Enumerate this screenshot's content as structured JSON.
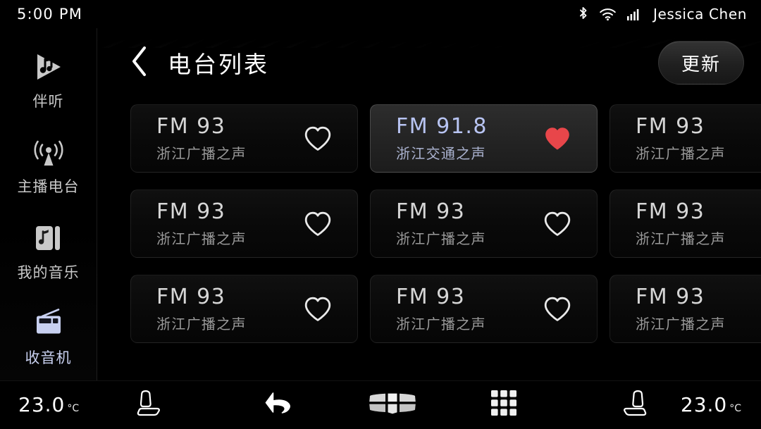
{
  "status_bar": {
    "clock": "5:00 PM",
    "user_name": "Jessica Chen",
    "icons": [
      "bluetooth-icon",
      "wifi-icon",
      "cellular-signal-icon"
    ]
  },
  "sidebar": {
    "items": [
      {
        "label": "伴听",
        "icon": "play-music-icon",
        "active": false
      },
      {
        "label": "主播电台",
        "icon": "broadcast-tower-icon",
        "active": false
      },
      {
        "label": "我的音乐",
        "icon": "music-album-icon",
        "active": false
      },
      {
        "label": "收音机",
        "icon": "radio-icon",
        "active": true
      }
    ]
  },
  "header": {
    "back_icon": "chevron-left-icon",
    "title": "电台列表",
    "update_label": "更新"
  },
  "stations": [
    {
      "frequency": "FM 93",
      "name": "浙江广播之声",
      "favorite": false,
      "selected": false
    },
    {
      "frequency": "FM 91.8",
      "name": "浙江交通之声",
      "favorite": true,
      "selected": true
    },
    {
      "frequency": "FM 93",
      "name": "浙江广播之声",
      "favorite": false,
      "selected": false
    },
    {
      "frequency": "FM 93",
      "name": "浙江广播之声",
      "favorite": false,
      "selected": false
    },
    {
      "frequency": "FM 93",
      "name": "浙江广播之声",
      "favorite": false,
      "selected": false
    },
    {
      "frequency": "FM 93",
      "name": "浙江广播之声",
      "favorite": false,
      "selected": false
    },
    {
      "frequency": "FM 93",
      "name": "浙江广播之声",
      "favorite": false,
      "selected": false
    },
    {
      "frequency": "FM 93",
      "name": "浙江广播之声",
      "favorite": false,
      "selected": false
    },
    {
      "frequency": "FM 93",
      "name": "浙江广播之声",
      "favorite": false,
      "selected": false
    }
  ],
  "bottom_bar": {
    "temp_left": "23.0",
    "temp_left_unit": "°C",
    "temp_right": "23.0",
    "temp_right_unit": "°C",
    "buttons": [
      "driver-seat-icon",
      "back-arrow-icon",
      "home-grille-icon",
      "apps-grid-icon",
      "passenger-seat-icon"
    ]
  },
  "colors": {
    "accent": "#c8d0f0",
    "favorite": "#e8464a",
    "selected_card_bg": "#242424",
    "card_bg": "#0a0a0a",
    "background": "#000000"
  }
}
